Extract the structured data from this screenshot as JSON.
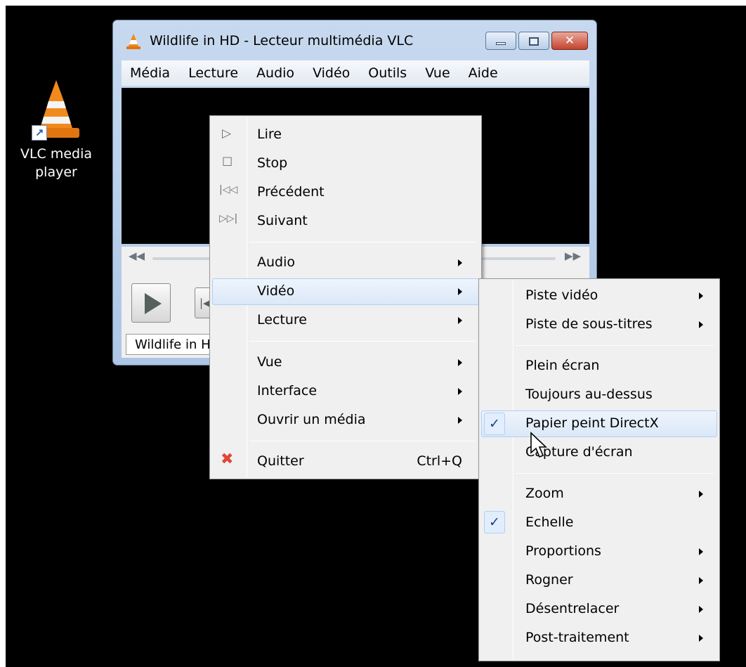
{
  "desktop": {
    "icon_label_line1": "VLC media",
    "icon_label_line2": "player",
    "background_color": "#000000"
  },
  "window": {
    "title": "Wildlife in HD - Lecteur multimédia VLC",
    "menu_bar": [
      "Média",
      "Lecture",
      "Audio",
      "Vidéo",
      "Outils",
      "Vue",
      "Aide"
    ],
    "status_text": "Wildlife in HD"
  },
  "context_menu": {
    "items": [
      {
        "label": "Lire",
        "icon": "play-outline-icon"
      },
      {
        "label": "Stop",
        "icon": "stop-icon"
      },
      {
        "label": "Précédent",
        "icon": "previous-icon"
      },
      {
        "label": "Suivant",
        "icon": "next-icon"
      },
      {
        "label": "Audio",
        "submenu": true
      },
      {
        "label": "Vidéo",
        "submenu": true,
        "highlighted": true
      },
      {
        "label": "Lecture",
        "submenu": true
      },
      {
        "label": "Vue",
        "submenu": true
      },
      {
        "label": "Interface",
        "submenu": true
      },
      {
        "label": "Ouvrir un média",
        "submenu": true
      },
      {
        "label": "Quitter",
        "icon": "close-x-icon",
        "shortcut": "Ctrl+Q"
      }
    ]
  },
  "video_submenu": {
    "items": [
      {
        "label": "Piste vidéo",
        "submenu": true
      },
      {
        "label": "Piste de sous-titres",
        "submenu": true
      },
      {
        "label": "Plein écran"
      },
      {
        "label": "Toujours au-dessus"
      },
      {
        "label": "Papier peint DirectX",
        "checked": true,
        "highlighted": true
      },
      {
        "label": "Capture d'écran"
      },
      {
        "label": "Zoom",
        "submenu": true
      },
      {
        "label": "Echelle",
        "checked": true
      },
      {
        "label": "Proportions",
        "submenu": true
      },
      {
        "label": "Rogner",
        "submenu": true
      },
      {
        "label": "Désentrelacer",
        "submenu": true
      },
      {
        "label": "Post-traitement",
        "submenu": true
      }
    ],
    "check_mark": "✓"
  },
  "colors": {
    "highlight": "#dbe8f8",
    "highlight_border": "#aecff7",
    "vlc_orange": "#f08a1c",
    "quit_red": "#e0463a"
  }
}
